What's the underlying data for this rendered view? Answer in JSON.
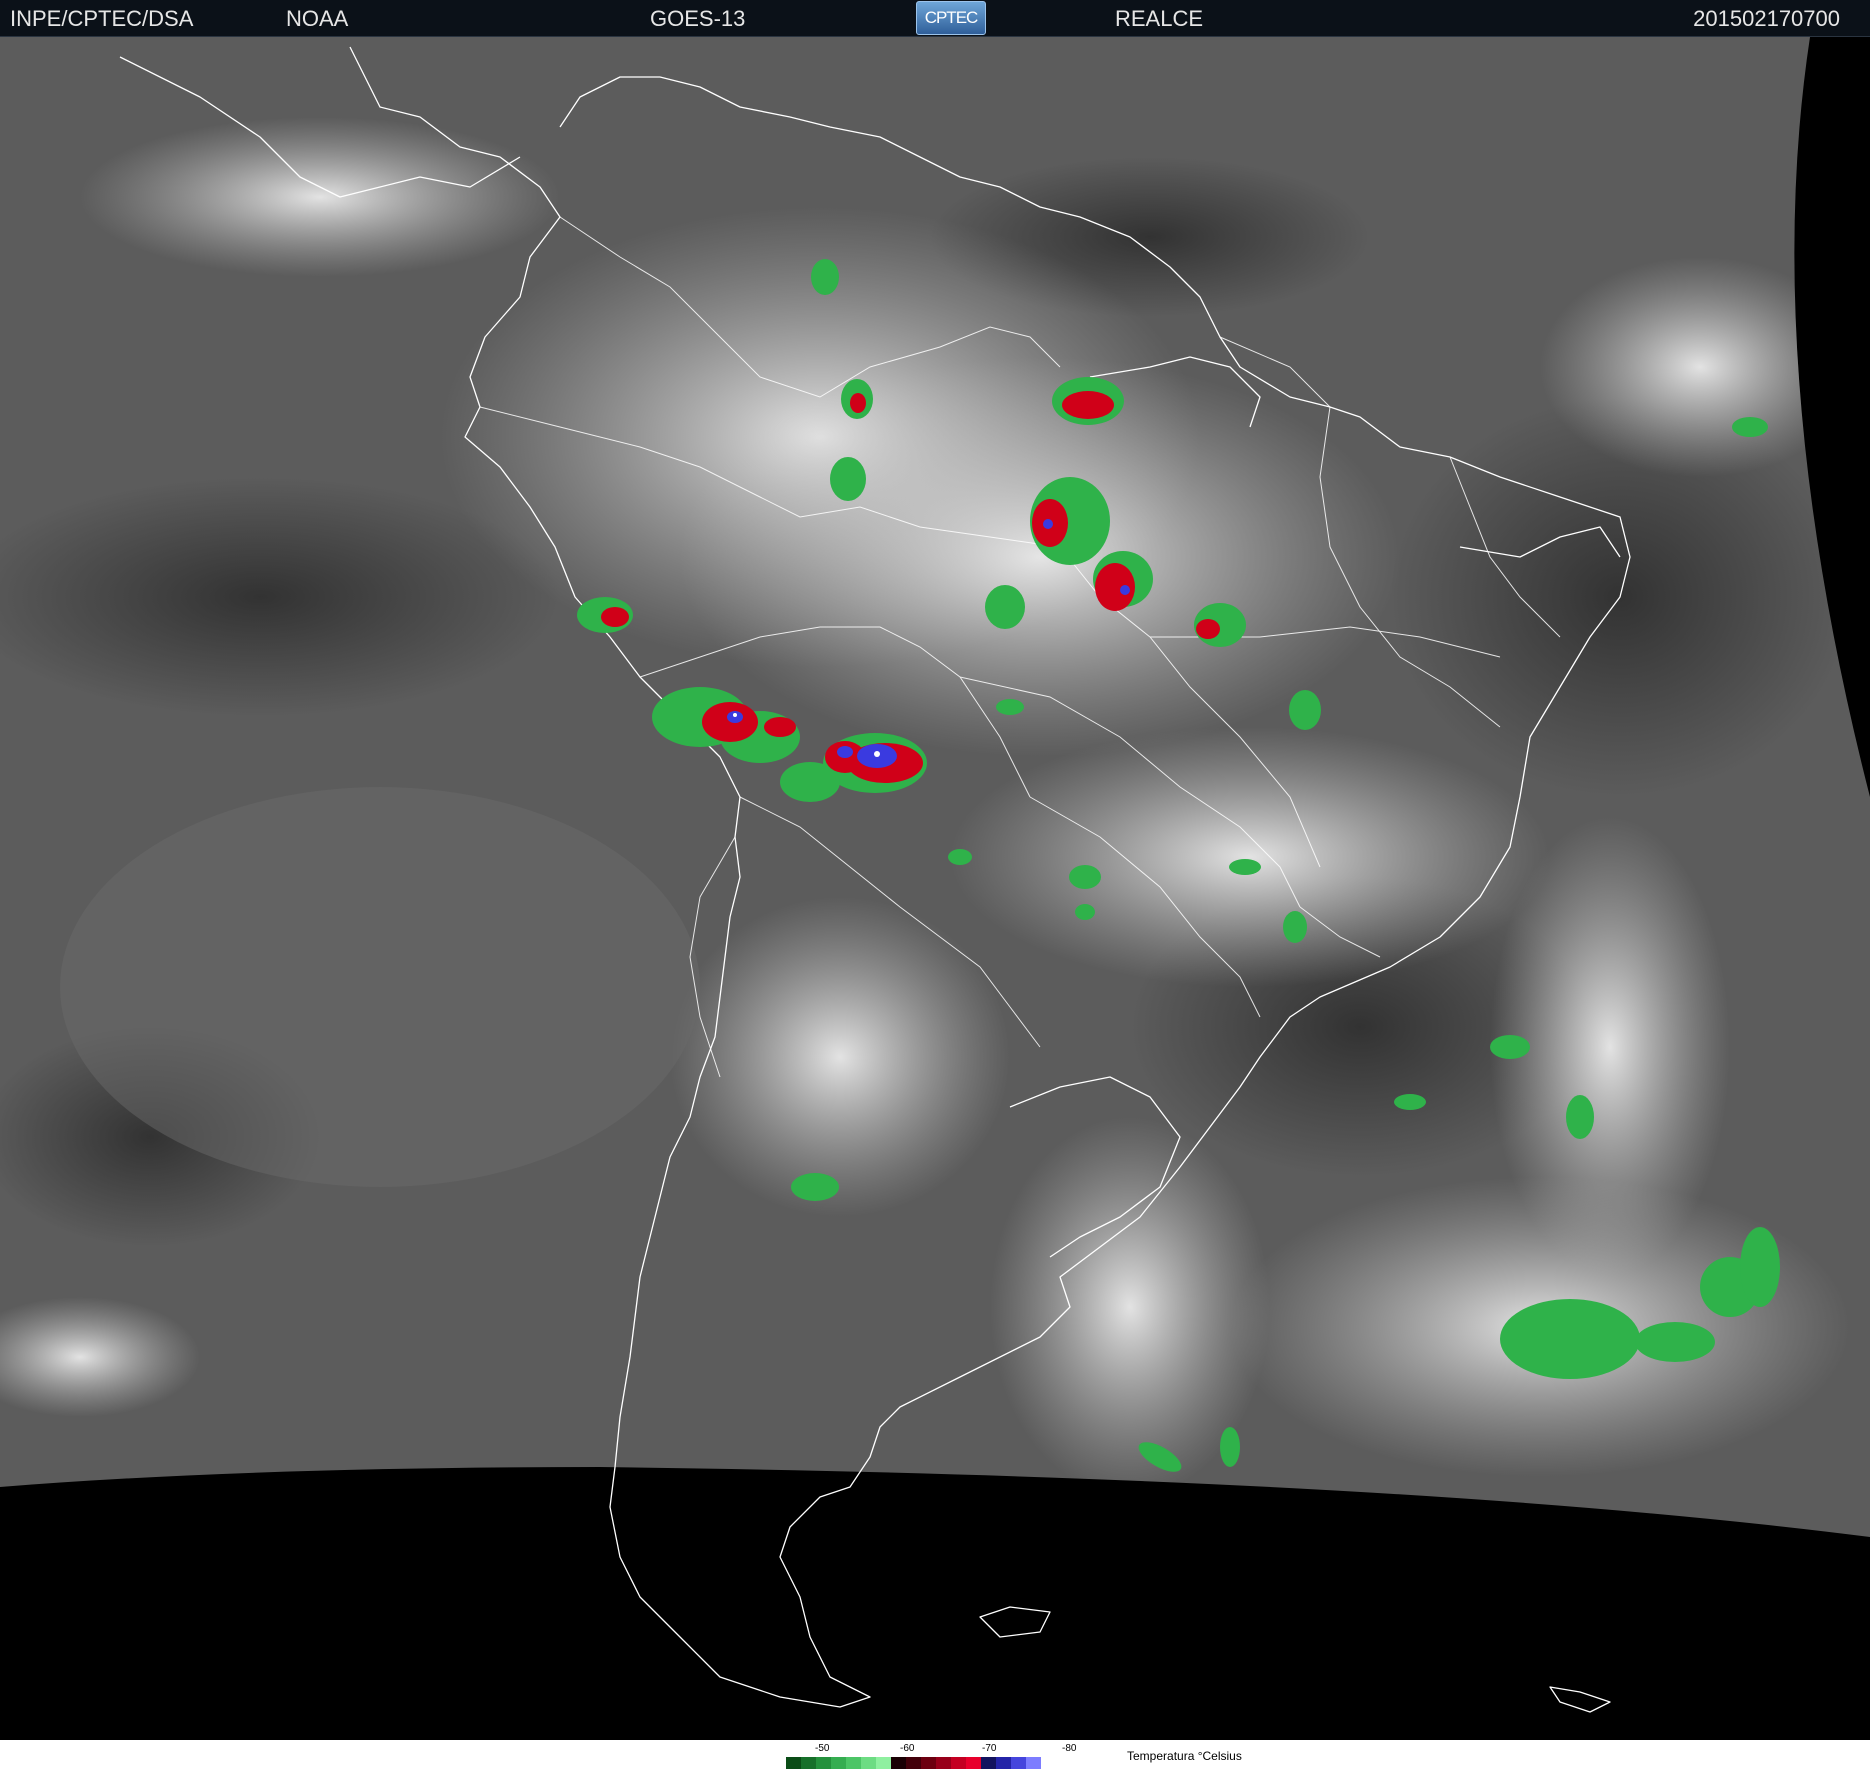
{
  "header": {
    "organization": "INPE/CPTEC/DSA",
    "agency": "NOAA",
    "satellite": "GOES-13",
    "logo_text": "CPTEC",
    "enhancement": "REALCE",
    "timestamp": "201502170700"
  },
  "legend": {
    "title": "Temperatura °Celsius",
    "ticks": [
      "-50",
      "-60",
      "-70",
      "-80"
    ],
    "colors": [
      "#0b4d17",
      "#17702a",
      "#24913c",
      "#35ad50",
      "#4cc566",
      "#6ddc83",
      "#8ff0a0",
      "#1a0004",
      "#43000a",
      "#6d0010",
      "#98001a",
      "#c40022",
      "#e8002c",
      "#13135e",
      "#2424a8",
      "#4545dd",
      "#7d7dff"
    ]
  },
  "map": {
    "background_color": "#5a5a5a",
    "earth_edge_color": "#000000",
    "coastline_color": "#ffffff",
    "cloud_color": "#e6e6e6",
    "cold_top_colors": {
      "green": "#2fb24a",
      "red": "#d00018",
      "blue": "#3a3ae0"
    }
  }
}
